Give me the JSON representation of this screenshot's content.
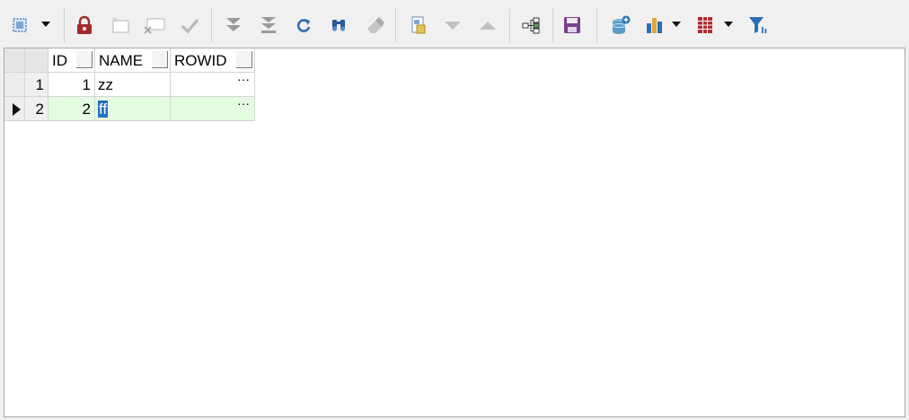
{
  "toolbar": {
    "icons": [
      "select-mode-icon",
      "lock-icon",
      "new-record-icon",
      "delete-record-icon",
      "post-icon",
      "move-down-icon",
      "move-last-icon",
      "refresh-icon",
      "find-icon",
      "eraser-icon",
      "details-icon",
      "next-icon",
      "previous-icon",
      "tree-icon",
      "save-icon",
      "database-icon",
      "chart-icon",
      "table-icon",
      "filter-icon"
    ]
  },
  "grid": {
    "columns": [
      "ID",
      "NAME",
      "ROWID"
    ],
    "rows": [
      {
        "row_num": "1",
        "id": "1",
        "name": "zz",
        "rowid": "···"
      },
      {
        "row_num": "2",
        "id": "2",
        "name": "ff",
        "rowid": "···"
      }
    ]
  },
  "colors": {
    "selected_row": "#e5fbe1",
    "edit_selection": "#1f6fc6",
    "lock": "#a52a2a",
    "save": "#7b3f8f",
    "filter": "#2a6fb5"
  }
}
